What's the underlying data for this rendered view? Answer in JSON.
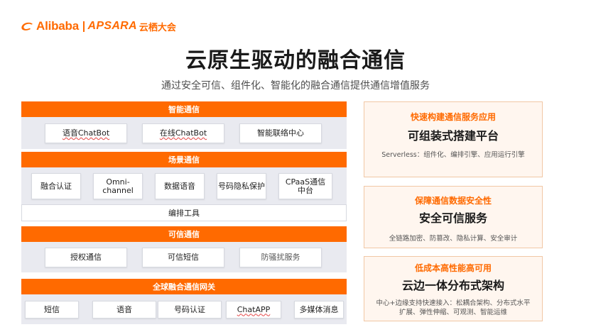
{
  "brand": {
    "name": "Alibaba",
    "product": "APSARA",
    "event": "云栖大会",
    "color": "#ff6a00"
  },
  "title": "云原生驱动的融合通信",
  "subtitle": "通过安全可信、组件化、智能化的融合通信提供通信增值服务",
  "layers": [
    {
      "name": "智能通信",
      "items": [
        "语音ChatBot",
        "在线ChatBot",
        "智能联络中心"
      ]
    },
    {
      "name": "场景通信",
      "items": [
        "融合认证",
        "Omni-\nchannel",
        "数据语音",
        "号码隐私保护",
        "CPaaS通信\n中台"
      ],
      "footer": "编排工具"
    },
    {
      "name": "可信通信",
      "items": [
        "授权通信",
        "可信短信",
        "防骚扰服务"
      ]
    },
    {
      "name": "全球融合通信网关",
      "items": [
        "短信",
        "语音",
        "号码认证",
        "ChatAPP",
        "多媒体消息"
      ]
    }
  ],
  "cards": [
    {
      "kicker": "快速构建通信服务应用",
      "title": "可组装式搭建平台",
      "desc": "Serverless：组件化、编排引擎、应用运行引擎"
    },
    {
      "kicker": "保障通信数据安全性",
      "title": "安全可信服务",
      "desc": "全链路加密、防篡改、隐私计算、安全审计"
    },
    {
      "kicker": "低成本高性能高可用",
      "title": "云边一体分布式架构",
      "desc": "中心+边缘支持快速接入：松耦合架构、分布式水平扩展、弹性伸缩、可观测、智能运维"
    }
  ],
  "colors": {
    "accent": "#ff6a00",
    "panel": "#e9eaf0",
    "card_bg": "#fff6ef",
    "card_border": "#f1c7a5"
  }
}
